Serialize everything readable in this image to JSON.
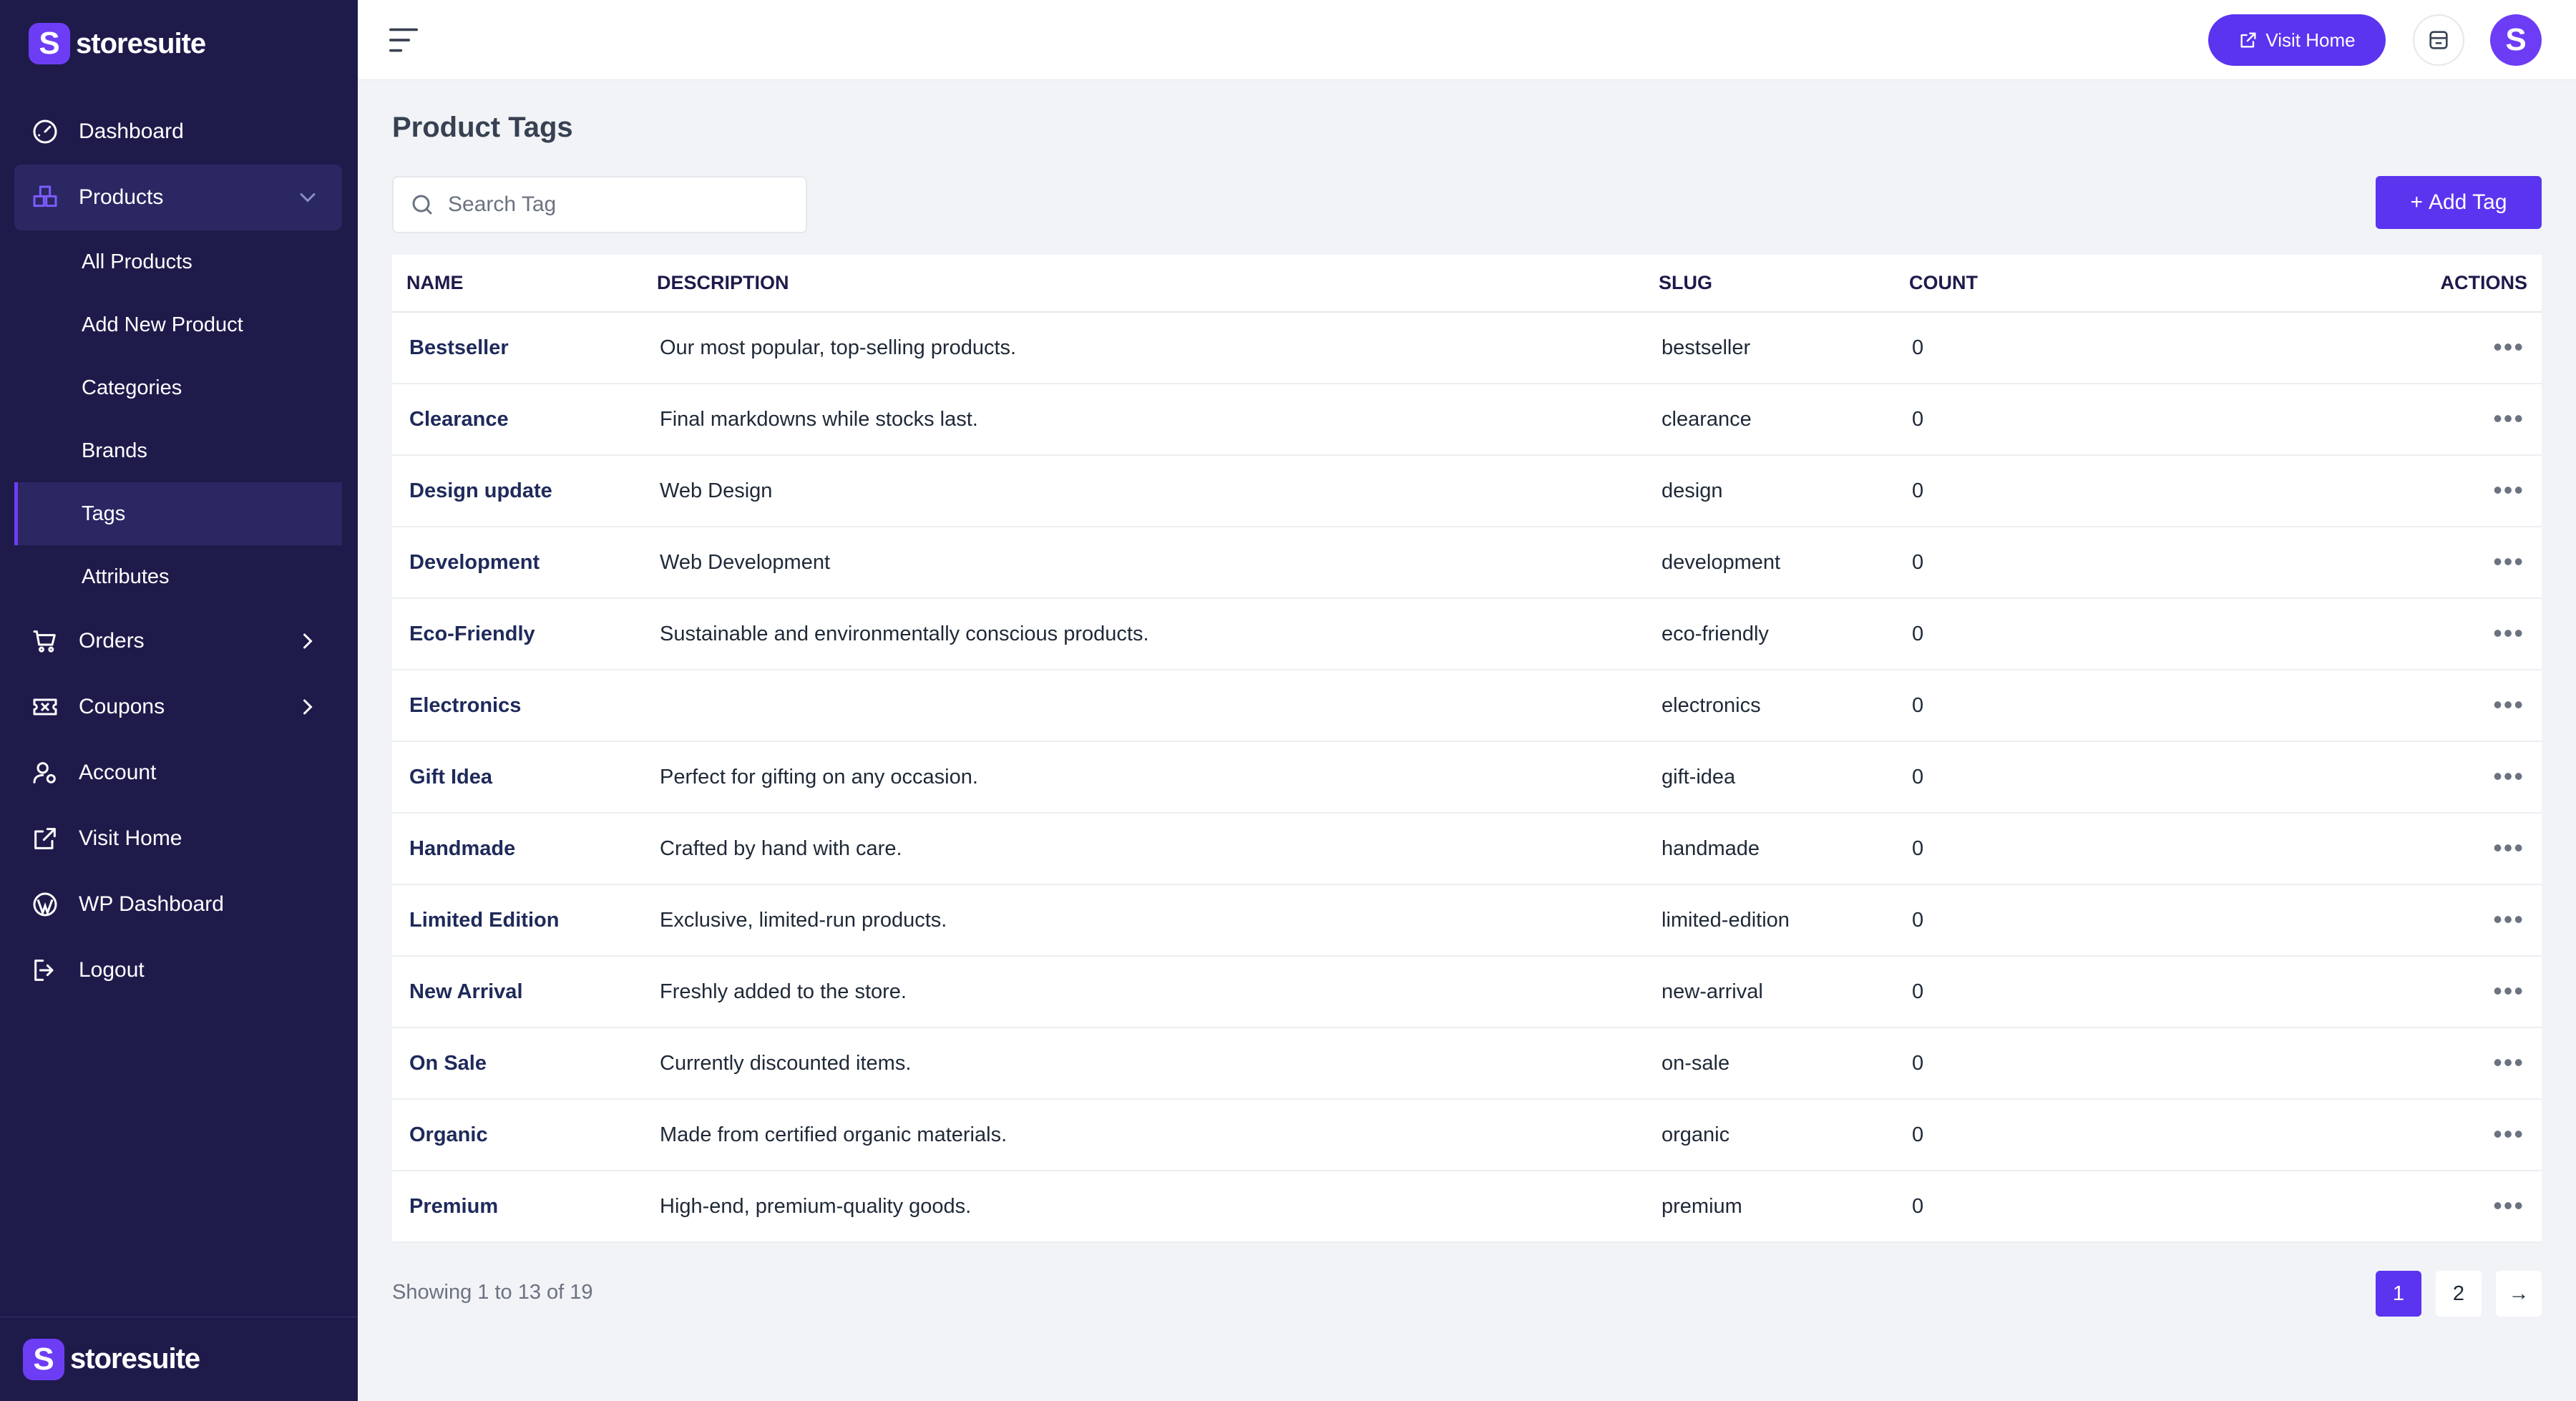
{
  "brand": {
    "name": "storesuite",
    "mark": "S"
  },
  "colors": {
    "sidebar": "#1e1b4b",
    "accent": "#5b34f0",
    "brand": "#6d3df5"
  },
  "sidebar": {
    "items": [
      {
        "label": "Dashboard",
        "icon": "gauge-icon"
      },
      {
        "label": "Products",
        "icon": "box-icon",
        "expanded": true,
        "children": [
          "All Products",
          "Add New Product",
          "Categories",
          "Brands",
          "Tags",
          "Attributes"
        ],
        "active_child": "Tags"
      },
      {
        "label": "Orders",
        "icon": "cart-icon"
      },
      {
        "label": "Coupons",
        "icon": "ticket-icon"
      },
      {
        "label": "Account",
        "icon": "user-gear-icon"
      },
      {
        "label": "Visit Home",
        "icon": "external-link-icon"
      },
      {
        "label": "WP Dashboard",
        "icon": "wordpress-icon"
      },
      {
        "label": "Logout",
        "icon": "logout-icon"
      }
    ]
  },
  "header": {
    "visit_home": "Visit Home"
  },
  "main": {
    "title": "Product Tags",
    "search_placeholder": "Search Tag",
    "add_label": "Add Tag",
    "columns": [
      "NAME",
      "DESCRIPTION",
      "SLUG",
      "COUNT",
      "ACTIONS"
    ],
    "rows": [
      {
        "name": "Bestseller",
        "description": "Our most popular, top-selling products.",
        "slug": "bestseller",
        "count": "0"
      },
      {
        "name": "Clearance",
        "description": "Final markdowns while stocks last.",
        "slug": "clearance",
        "count": "0"
      },
      {
        "name": "Design update",
        "description": "Web Design",
        "slug": "design",
        "count": "0"
      },
      {
        "name": "Development",
        "description": "Web Development",
        "slug": "development",
        "count": "0"
      },
      {
        "name": "Eco-Friendly",
        "description": "Sustainable and environmentally conscious products.",
        "slug": "eco-friendly",
        "count": "0"
      },
      {
        "name": "Electronics",
        "description": "",
        "slug": "electronics",
        "count": "0"
      },
      {
        "name": "Gift Idea",
        "description": "Perfect for gifting on any occasion.",
        "slug": "gift-idea",
        "count": "0"
      },
      {
        "name": "Handmade",
        "description": "Crafted by hand with care.",
        "slug": "handmade",
        "count": "0"
      },
      {
        "name": "Limited Edition",
        "description": "Exclusive, limited-run products.",
        "slug": "limited-edition",
        "count": "0"
      },
      {
        "name": "New Arrival",
        "description": "Freshly added to the store.",
        "slug": "new-arrival",
        "count": "0"
      },
      {
        "name": "On Sale",
        "description": "Currently discounted items.",
        "slug": "on-sale",
        "count": "0"
      },
      {
        "name": "Organic",
        "description": "Made from certified organic materials.",
        "slug": "organic",
        "count": "0"
      },
      {
        "name": "Premium",
        "description": "High-end, premium-quality goods.",
        "slug": "premium",
        "count": "0"
      }
    ],
    "row_action": "•••",
    "showing": "Showing 1 to 13 of 19",
    "pages": [
      "1",
      "2"
    ],
    "current_page": "1",
    "next_symbol": "→"
  }
}
